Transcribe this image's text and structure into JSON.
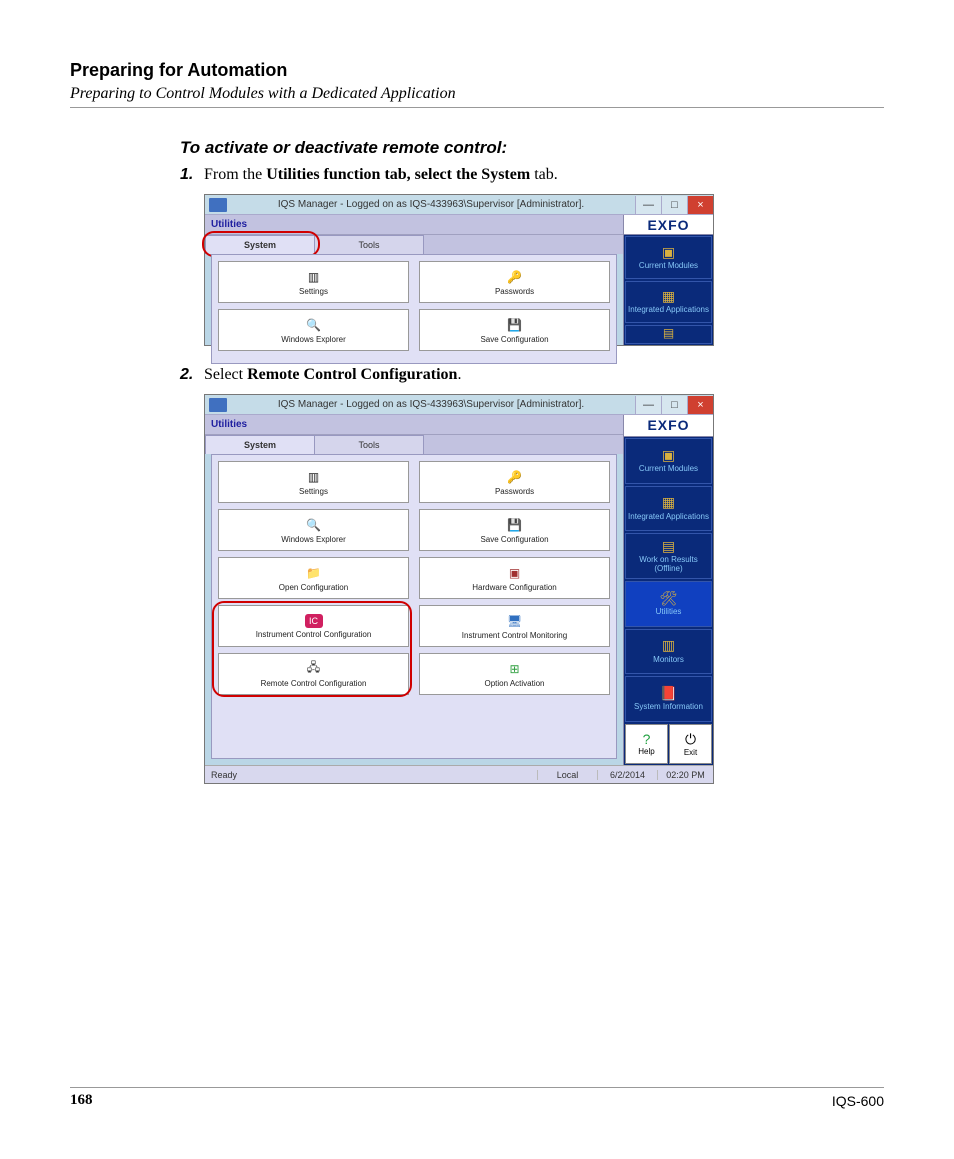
{
  "header": {
    "title": "Preparing for Automation",
    "subtitle": "Preparing to Control Modules with a Dedicated Application"
  },
  "body": {
    "section_heading": "To activate or deactivate remote control:",
    "step1_prefix": "1.",
    "step1_a": "From the ",
    "step1_b": "Utilities function tab, select the System",
    "step1_c": " tab.",
    "step2_prefix": "2.",
    "step2_a": "Select ",
    "step2_b": "Remote Control Configuration",
    "step2_c": "."
  },
  "window": {
    "title": "IQS Manager - Logged on as IQS-433963\\Supervisor [Administrator].",
    "min": "—",
    "max": "□",
    "close": "×",
    "panel_label": "Utilities",
    "tab_system": "System",
    "tab_tools": "Tools",
    "logo": "EXFO"
  },
  "grid": {
    "settings": "Settings",
    "passwords": "Passwords",
    "win_explorer": "Windows Explorer",
    "save_config": "Save Configuration",
    "open_config": "Open Configuration",
    "hw_config": "Hardware Configuration",
    "instr_ctrl_config": "Instrument Control Configuration",
    "instr_ctrl_mon": "Instrument Control Monitoring",
    "rcc": "Remote Control Configuration",
    "opt_act": "Option Activation"
  },
  "nav": {
    "current_modules": "Current Modules",
    "integrated_apps": "Integrated Applications",
    "work_offline": "Work on Results (Offline)",
    "utilities": "Utilities",
    "monitors": "Monitors",
    "sys_info": "System Information",
    "help": "Help",
    "exit": "Exit"
  },
  "status": {
    "ready": "Ready",
    "local": "Local",
    "date": "6/2/2014",
    "time": "02:20 PM"
  },
  "footer": {
    "page": "168",
    "model": "IQS-600"
  }
}
